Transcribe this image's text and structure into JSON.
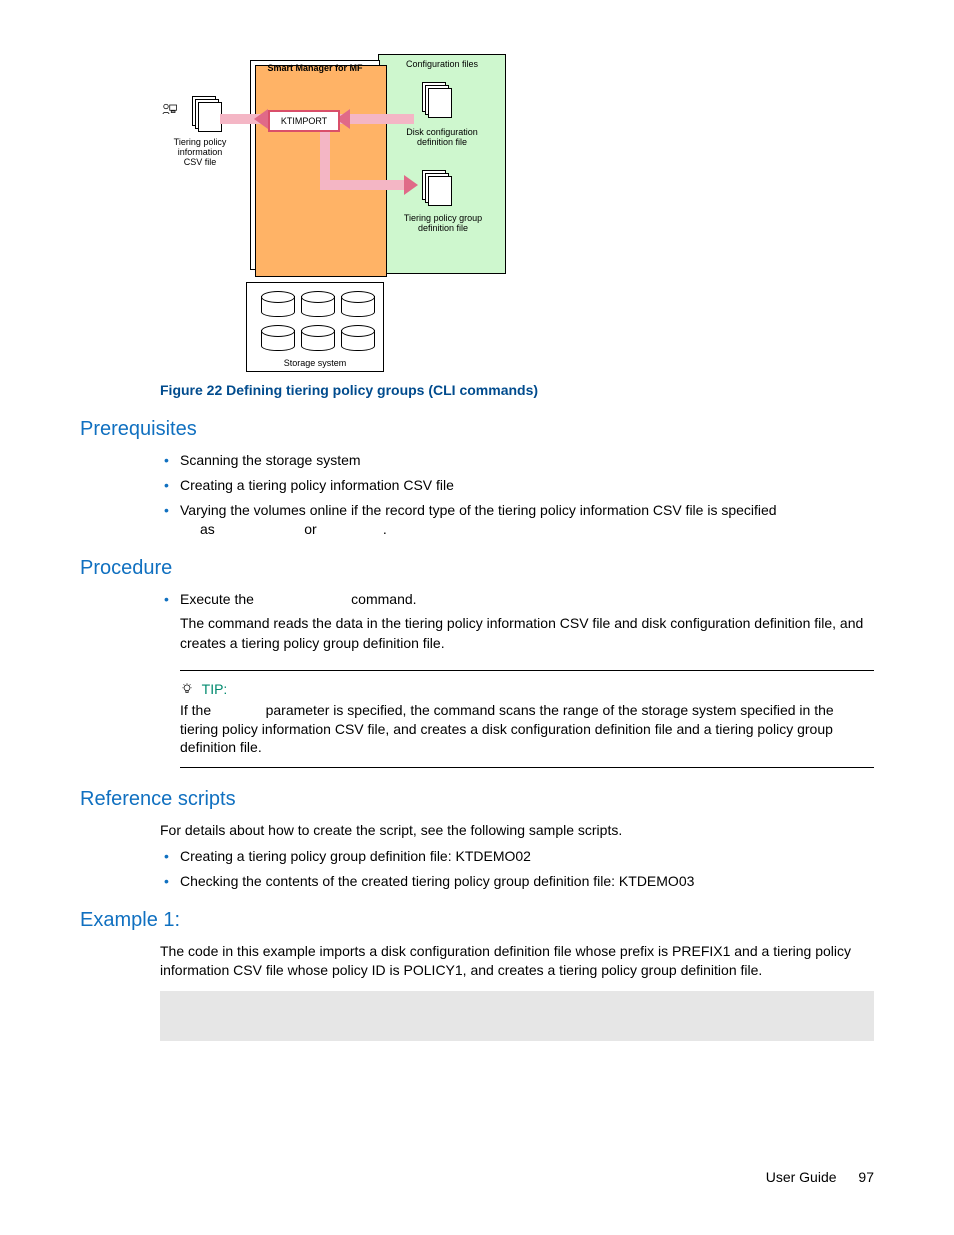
{
  "figure": {
    "smart_mgr_label": "Smart Manager for MF",
    "config_files_label": "Configuration files",
    "ktimport_label": "KTIMPORT",
    "csv_label": "Tiering policy\ninformation\nCSV file",
    "disk_cfg_label": "Disk configuration\ndefinition file",
    "tpg_label": "Tiering policy group\ndefinition file",
    "storage_label": "Storage system",
    "caption": "Figure 22 Defining tiering policy groups (CLI commands)"
  },
  "sections": {
    "prereq_heading": "Prerequisites",
    "prereq_items": {
      "i0": "Scanning the storage system",
      "i1": "Creating a tiering policy information CSV file",
      "i2_a": "Varying the volumes online if the record type of the tiering policy information CSV file is specified",
      "i2_b": "as                       or                 ."
    },
    "proc_heading": "Procedure",
    "proc_items": {
      "i0": "Execute the                         command."
    },
    "proc_body": "The command reads the data in the tiering policy information CSV file and disk configuration definition file, and creates a tiering policy group definition file.",
    "tip_label": "TIP:",
    "tip_body": "If the              parameter is specified, the command scans the range of the storage system specified in the tiering policy information CSV file, and creates a disk configuration definition file and a tiering policy group definition file.",
    "ref_heading": "Reference scripts",
    "ref_intro": "For details about how to create the script, see the following sample scripts.",
    "ref_items": {
      "i0": "Creating a tiering policy group definition file: KTDEMO02",
      "i1": "Checking the contents of the created tiering policy group definition file: KTDEMO03"
    },
    "ex_heading": "Example 1:",
    "ex_body": "The code in this example imports a disk configuration definition file whose prefix is PREFIX1 and a tiering policy information CSV file whose policy ID is POLICY1, and creates a tiering policy group definition file.",
    "code": " "
  },
  "footer": {
    "guide": "User Guide",
    "page": "97"
  }
}
